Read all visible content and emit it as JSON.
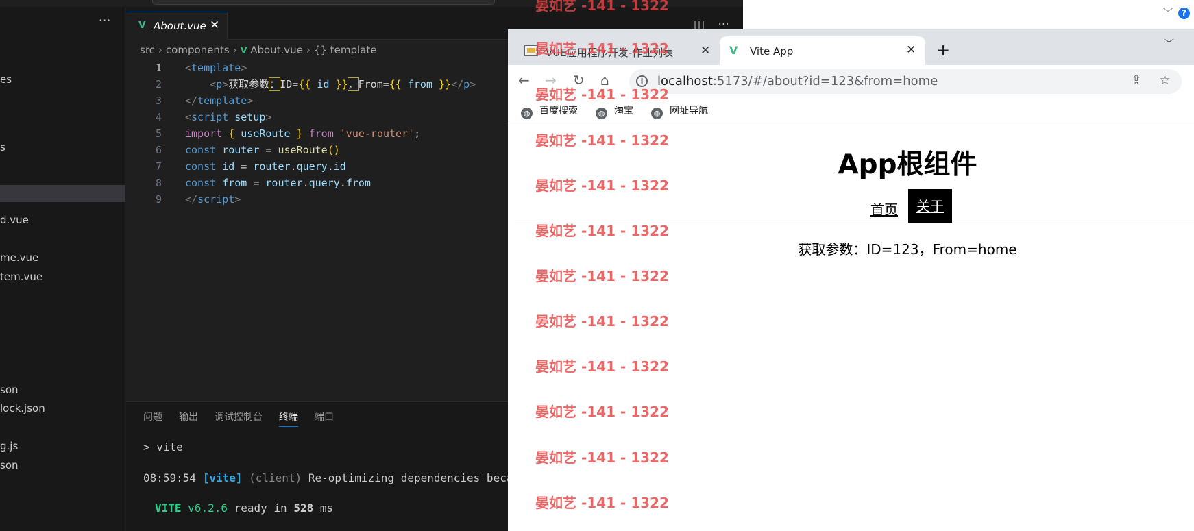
{
  "vscode": {
    "sidebar": {
      "more": "···",
      "items": [
        "es",
        "s",
        "d.vue",
        "me.vue",
        "tem.vue",
        "son",
        "lock.json",
        "g.js",
        "son"
      ]
    },
    "tab": {
      "name": "About.vue",
      "close": "✕"
    },
    "editor_actions": [
      "◫",
      "···"
    ],
    "breadcrumb": {
      "parts": [
        "src",
        "components",
        "About.vue",
        "template"
      ],
      "sep": "›",
      "brace": "{}"
    },
    "code": [
      {
        "n": "1",
        "parts": [
          {
            "c": "t-tag",
            "t": "<"
          },
          {
            "c": "t-name",
            "t": "template"
          },
          {
            "c": "t-tag",
            "t": ">"
          }
        ]
      },
      {
        "n": "2",
        "parts": [
          {
            "c": "t-txt",
            "t": "    "
          },
          {
            "c": "t-tag",
            "t": "<"
          },
          {
            "c": "t-name",
            "t": "p"
          },
          {
            "c": "t-tag",
            "t": ">"
          },
          {
            "c": "t-txt",
            "t": "获取参数"
          },
          {
            "c": "t-txt hl",
            "t": "："
          },
          {
            "c": "t-txt",
            "t": "ID="
          },
          {
            "c": "t-br",
            "t": "{{"
          },
          {
            "c": "t-var",
            "t": " id "
          },
          {
            "c": "t-br",
            "t": "}}"
          },
          {
            "c": "t-txt hl",
            "t": "，"
          },
          {
            "c": "t-txt",
            "t": "From="
          },
          {
            "c": "t-br",
            "t": "{{"
          },
          {
            "c": "t-var",
            "t": " from "
          },
          {
            "c": "t-br",
            "t": "}}"
          },
          {
            "c": "t-tag",
            "t": "</"
          },
          {
            "c": "t-name",
            "t": "p"
          },
          {
            "c": "t-tag",
            "t": ">"
          }
        ]
      },
      {
        "n": "3",
        "parts": [
          {
            "c": "t-tag",
            "t": "</"
          },
          {
            "c": "t-name",
            "t": "template"
          },
          {
            "c": "t-tag",
            "t": ">"
          }
        ]
      },
      {
        "n": "4",
        "parts": [
          {
            "c": "t-tag",
            "t": "<"
          },
          {
            "c": "t-name",
            "t": "script"
          },
          {
            "c": "t-txt",
            "t": " "
          },
          {
            "c": "t-var",
            "t": "setup"
          },
          {
            "c": "t-tag",
            "t": ">"
          }
        ]
      },
      {
        "n": "5",
        "parts": [
          {
            "c": "t-kw",
            "t": "import"
          },
          {
            "c": "t-txt",
            "t": " "
          },
          {
            "c": "t-br",
            "t": "{"
          },
          {
            "c": "t-var",
            "t": " useRoute "
          },
          {
            "c": "t-br",
            "t": "}"
          },
          {
            "c": "t-txt",
            "t": " "
          },
          {
            "c": "t-kw",
            "t": "from"
          },
          {
            "c": "t-txt",
            "t": " "
          },
          {
            "c": "t-str",
            "t": "'vue-router'"
          },
          {
            "c": "t-txt",
            "t": ";"
          }
        ]
      },
      {
        "n": "6",
        "parts": [
          {
            "c": "t-kw2",
            "t": "const"
          },
          {
            "c": "t-txt",
            "t": " "
          },
          {
            "c": "t-var",
            "t": "router"
          },
          {
            "c": "t-txt",
            "t": " = "
          },
          {
            "c": "t-fn",
            "t": "useRoute"
          },
          {
            "c": "t-br",
            "t": "()"
          }
        ]
      },
      {
        "n": "7",
        "parts": [
          {
            "c": "t-kw2",
            "t": "const"
          },
          {
            "c": "t-txt",
            "t": " "
          },
          {
            "c": "t-var",
            "t": "id"
          },
          {
            "c": "t-txt",
            "t": " = "
          },
          {
            "c": "t-var",
            "t": "router"
          },
          {
            "c": "t-txt",
            "t": "."
          },
          {
            "c": "t-var",
            "t": "query"
          },
          {
            "c": "t-txt",
            "t": "."
          },
          {
            "c": "t-var",
            "t": "id"
          }
        ]
      },
      {
        "n": "8",
        "parts": [
          {
            "c": "t-kw2",
            "t": "const"
          },
          {
            "c": "t-txt",
            "t": " "
          },
          {
            "c": "t-var",
            "t": "from"
          },
          {
            "c": "t-txt",
            "t": " = "
          },
          {
            "c": "t-var",
            "t": "router"
          },
          {
            "c": "t-txt",
            "t": "."
          },
          {
            "c": "t-var",
            "t": "query"
          },
          {
            "c": "t-txt",
            "t": "."
          },
          {
            "c": "t-var",
            "t": "from"
          }
        ]
      },
      {
        "n": "9",
        "parts": [
          {
            "c": "t-tag",
            "t": "</"
          },
          {
            "c": "t-name",
            "t": "script"
          },
          {
            "c": "t-tag",
            "t": ">"
          }
        ]
      }
    ],
    "panel": {
      "tabs": [
        "问题",
        "输出",
        "调试控制台",
        "终端",
        "端口"
      ],
      "active_tab": "终端",
      "terminal": {
        "prompt": "> vite",
        "time": "08:59:54",
        "tag": "[vite]",
        "client": "(client)",
        "msg": " Re-optimizing dependencies because",
        "vite_name": "VITE",
        "vite_ver": "v6.2.6",
        "ready_a": "ready in",
        "ready_ms": "528",
        "ready_unit": "ms"
      }
    }
  },
  "chrome": {
    "tabs": [
      {
        "title": "VUE应用程序开发-作业列表",
        "close": "✕"
      },
      {
        "title": "Vite App",
        "close": "✕"
      }
    ],
    "new_tab": "+",
    "url": {
      "host": "localhost",
      "rest": ":5173/#/about?id=123&from=home"
    },
    "bookmarks": [
      "百度搜索",
      "淘宝",
      "网址导航"
    ],
    "page": {
      "h1": "App根组件",
      "nav_home": "首页",
      "nav_about": "关于",
      "param": "获取参数：ID=123，From=home"
    }
  },
  "watermark": {
    "text": "晏如艺 -141 - 1322",
    "color": "#e54646"
  }
}
